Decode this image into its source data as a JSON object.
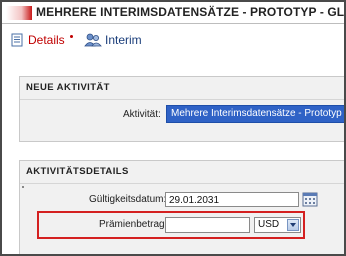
{
  "window": {
    "title": "MEHRERE INTERIMSDATENSÄTZE - PROTOTYP  -  GL"
  },
  "toolbar": {
    "details_label": "Details",
    "interim_label": "Interim"
  },
  "sections": {
    "neue_aktivitaet": {
      "header": "NEUE AKTIVITÄT",
      "activity_label": "Aktivität:",
      "activity_value": "Mehrere Interimsdatensätze - Prototyp"
    },
    "aktivitaetsdetails": {
      "header": "AKTIVITÄTSDETAILS",
      "validity_label": "Gültigkeitsdatum:",
      "validity_value": "29.01.2031",
      "premium_label": "Prämienbetrag:",
      "premium_value": "",
      "currency_value": "USD"
    }
  },
  "colors": {
    "accent_red": "#c00000",
    "highlight_blue": "#2f62c6",
    "callout_red": "#d42020"
  },
  "icons": {
    "details": "document-icon",
    "interim": "people-icon",
    "calendar": "calendar-icon",
    "dropdown": "chevron-down-icon"
  }
}
